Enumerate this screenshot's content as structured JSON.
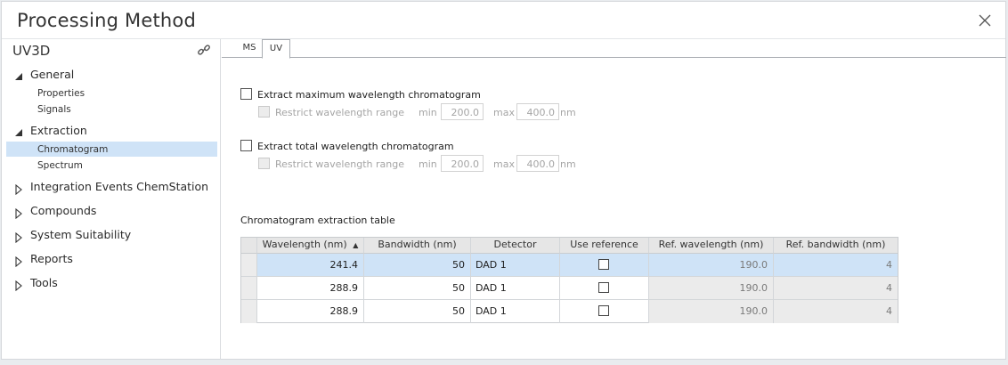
{
  "window": {
    "title": "Processing Method"
  },
  "sidebar": {
    "heading": "UV3D",
    "tree": [
      {
        "label": "General",
        "expanded": true,
        "children": [
          "Properties",
          "Signals"
        ]
      },
      {
        "label": "Extraction",
        "expanded": true,
        "children": [
          "Chromatogram",
          "Spectrum"
        ],
        "selected_child": "Chromatogram"
      },
      {
        "label": "Integration Events ChemStation",
        "expanded": false
      },
      {
        "label": "Compounds",
        "expanded": false
      },
      {
        "label": "System Suitability",
        "expanded": false
      },
      {
        "label": "Reports",
        "expanded": false
      },
      {
        "label": "Tools",
        "expanded": false
      }
    ]
  },
  "tabs": [
    {
      "label": "MS",
      "active": false
    },
    {
      "label": "UV",
      "active": true
    }
  ],
  "extract_max": {
    "label": "Extract maximum wavelength chromatogram",
    "checked": false,
    "restrict_label": "Restrict wavelength range",
    "min_label": "min",
    "min_value": "200.0",
    "max_label": "max",
    "max_value": "400.0",
    "unit": "nm"
  },
  "extract_total": {
    "label": "Extract total wavelength chromatogram",
    "checked": false,
    "restrict_label": "Restrict wavelength range",
    "min_label": "min",
    "min_value": "200.0",
    "max_label": "max",
    "max_value": "400.0",
    "unit": "nm"
  },
  "table": {
    "title": "Chromatogram extraction table",
    "columns": [
      "Wavelength (nm)",
      "Bandwidth (nm)",
      "Detector",
      "Use reference",
      "Ref. wavelength (nm)",
      "Ref. bandwidth (nm)"
    ],
    "sort_column": "Wavelength (nm)",
    "sort_indicator": "▲",
    "rows": [
      {
        "wavelength": "241.4",
        "bandwidth": "50",
        "detector": "DAD 1",
        "use_reference": false,
        "ref_wavelength": "190.0",
        "ref_bandwidth": "4",
        "selected": true
      },
      {
        "wavelength": "288.9",
        "bandwidth": "50",
        "detector": "DAD 1",
        "use_reference": false,
        "ref_wavelength": "190.0",
        "ref_bandwidth": "4",
        "selected": false
      },
      {
        "wavelength": "288.9",
        "bandwidth": "50",
        "detector": "DAD 1",
        "use_reference": false,
        "ref_wavelength": "190.0",
        "ref_bandwidth": "4",
        "selected": false
      }
    ]
  },
  "colors": {
    "selection": "#cfe3f7",
    "header_bg": "#e6e6e6",
    "disabled_text": "#a5a5a5"
  }
}
